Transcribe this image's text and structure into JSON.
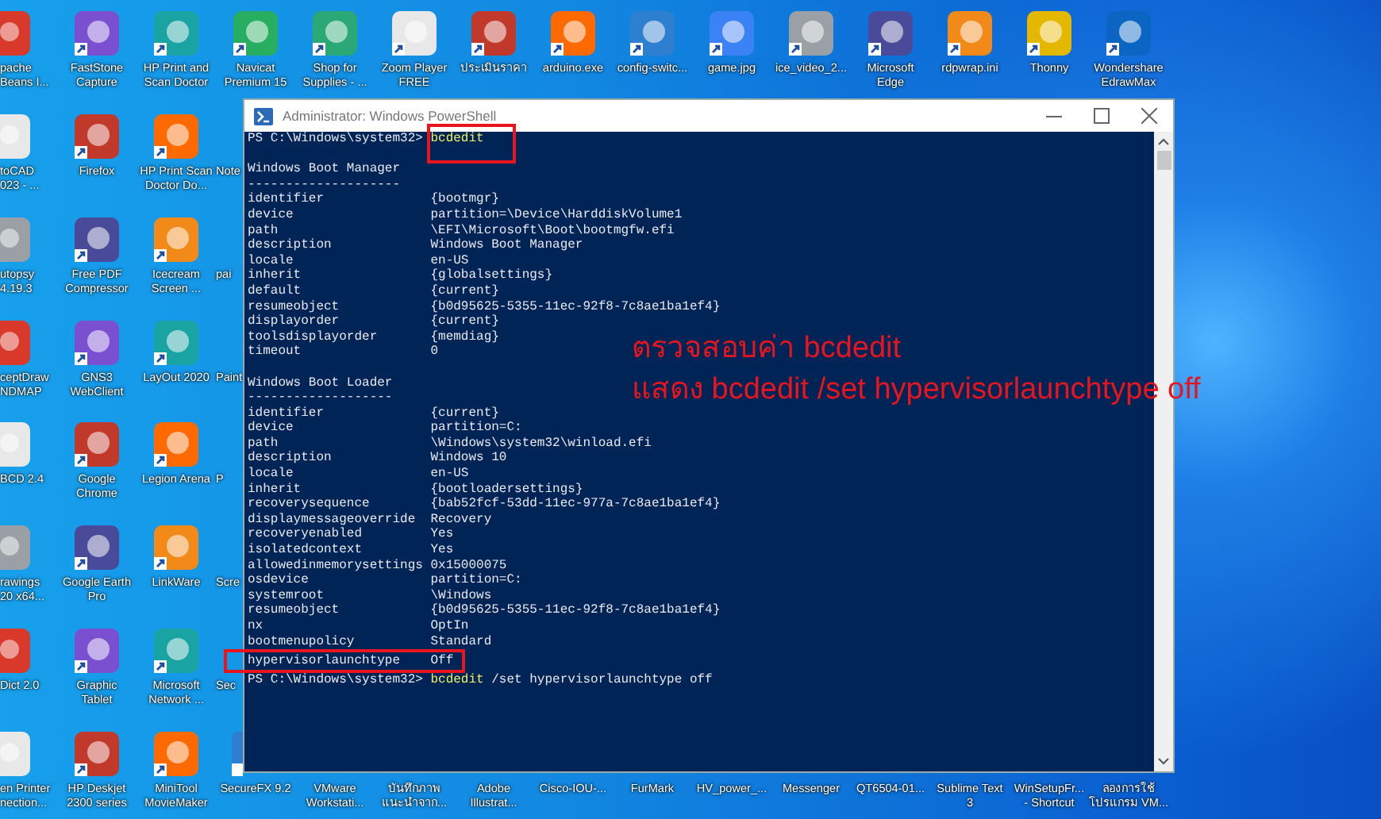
{
  "desktop": {
    "columns": [
      {
        "icons": [
          {
            "label": "pache\nBeans I...",
            "kind": "cut"
          },
          {
            "label": "toCAD\n023 - ...",
            "kind": "cut"
          },
          {
            "label": "utopsy\n4.19.3",
            "kind": "cut"
          },
          {
            "label": "ceptDraw\nNDMAP",
            "kind": "cut"
          },
          {
            "label": "BCD 2.4",
            "kind": "cut"
          },
          {
            "label": "rawings\n20 x64...",
            "kind": "cut"
          },
          {
            "label": "Dict 2.0",
            "kind": "cut"
          },
          {
            "label": "en Printer\nnection...",
            "kind": "cut"
          }
        ]
      },
      {
        "icons": [
          {
            "label": "FastStone\nCapture",
            "kind": "full"
          },
          {
            "label": "Firefox",
            "kind": "full"
          },
          {
            "label": "Free PDF\nCompressor",
            "kind": "full"
          },
          {
            "label": "GNS3\nWebClient",
            "kind": "full"
          },
          {
            "label": "Google\nChrome",
            "kind": "full"
          },
          {
            "label": "Google Earth\nPro",
            "kind": "full"
          },
          {
            "label": "Graphic\nTablet",
            "kind": "full"
          },
          {
            "label": "HP Deskjet\n2300 series",
            "kind": "full"
          }
        ]
      },
      {
        "icons": [
          {
            "label": "HP Print and\nScan Doctor",
            "kind": "full"
          },
          {
            "label": "HP Print Scan\nDoctor Do...",
            "kind": "full"
          },
          {
            "label": "Icecream\nScreen ...",
            "kind": "full"
          },
          {
            "label": "LayOut 2020",
            "kind": "full"
          },
          {
            "label": "Legion Arena",
            "kind": "full"
          },
          {
            "label": "LinkWare",
            "kind": "full"
          },
          {
            "label": "Microsoft\nNetwork ...",
            "kind": "full"
          },
          {
            "label": "MiniTool\nMovieMaker",
            "kind": "full"
          }
        ]
      },
      {
        "icons": [
          {
            "label": "Navicat\nPremium 15",
            "kind": "full"
          },
          {
            "label": "Note",
            "kind": "cut"
          },
          {
            "label": "pai",
            "kind": "cut"
          },
          {
            "label": "Paint",
            "kind": "cut"
          },
          {
            "label": "P",
            "kind": "cut"
          },
          {
            "label": "Scre",
            "kind": "cut"
          },
          {
            "label": "Sec",
            "kind": "cut"
          },
          {
            "label": "SecureFX 9.2",
            "kind": "edge"
          }
        ]
      },
      {
        "icons": [
          {
            "label": "Shop for\nSupplies - ...",
            "kind": "full"
          },
          {
            "label": "VMware\nWorkstati...",
            "kind": "label"
          }
        ]
      },
      {
        "icons": [
          {
            "label": "Zoom Player\nFREE",
            "kind": "full"
          },
          {
            "label": "บันทึกภาพ\nแนะนำจาก...",
            "kind": "label"
          }
        ]
      },
      {
        "icons": [
          {
            "label": "ประเมินราคา",
            "kind": "full"
          },
          {
            "label": "Adobe\nIllustrat...",
            "kind": "label"
          }
        ]
      },
      {
        "icons": [
          {
            "label": "arduino.exe",
            "kind": "full"
          },
          {
            "label": "Cisco-IOU-...",
            "kind": "label"
          }
        ]
      },
      {
        "icons": [
          {
            "label": "config-switc...",
            "kind": "full"
          },
          {
            "label": "FurMark",
            "kind": "label"
          }
        ]
      },
      {
        "icons": [
          {
            "label": "game.jpg",
            "kind": "full"
          },
          {
            "label": "HV_power_...",
            "kind": "label"
          }
        ]
      },
      {
        "icons": [
          {
            "label": "ice_video_2...",
            "kind": "full"
          },
          {
            "label": "Messenger",
            "kind": "label"
          }
        ]
      },
      {
        "icons": [
          {
            "label": "Microsoft\nEdge",
            "kind": "full"
          },
          {
            "label": "QT6504-01...",
            "kind": "label"
          }
        ]
      },
      {
        "icons": [
          {
            "label": "rdpwrap.ini",
            "kind": "full"
          },
          {
            "label": "Sublime Text\n3",
            "kind": "label"
          }
        ]
      },
      {
        "icons": [
          {
            "label": "Thonny",
            "kind": "full"
          },
          {
            "label": "WinSetupFr...\n- Shortcut",
            "kind": "label"
          }
        ]
      },
      {
        "icons": [
          {
            "label": "Wondershare\nEdrawMax",
            "kind": "full"
          },
          {
            "label": "ลองการใช้\nโปรแกรม VM...",
            "kind": "label"
          }
        ]
      }
    ]
  },
  "window": {
    "title": "Administrator: Windows PowerShell",
    "lines": [
      {
        "kind": "prompt",
        "prompt": "PS C:\\Windows\\system32>",
        "command": "bcdedit",
        "highlighted": true
      },
      {
        "kind": "blank"
      },
      {
        "kind": "heading",
        "text": "Windows Boot Manager"
      },
      {
        "kind": "heading",
        "text": "--------------------"
      },
      {
        "kind": "entry",
        "key": "identifier",
        "value": "{bootmgr}"
      },
      {
        "kind": "entry",
        "key": "device",
        "value": "partition=\\Device\\HarddiskVolume1"
      },
      {
        "kind": "entry",
        "key": "path",
        "value": "\\EFI\\Microsoft\\Boot\\bootmgfw.efi"
      },
      {
        "kind": "entry",
        "key": "description",
        "value": "Windows Boot Manager"
      },
      {
        "kind": "entry",
        "key": "locale",
        "value": "en-US"
      },
      {
        "kind": "entry",
        "key": "inherit",
        "value": "{globalsettings}"
      },
      {
        "kind": "entry",
        "key": "default",
        "value": "{current}"
      },
      {
        "kind": "entry",
        "key": "resumeobject",
        "value": "{b0d95625-5355-11ec-92f8-7c8ae1ba1ef4}"
      },
      {
        "kind": "entry",
        "key": "displayorder",
        "value": "{current}"
      },
      {
        "kind": "entry",
        "key": "toolsdisplayorder",
        "value": "{memdiag}"
      },
      {
        "kind": "entry",
        "key": "timeout",
        "value": "0"
      },
      {
        "kind": "blank"
      },
      {
        "kind": "heading",
        "text": "Windows Boot Loader"
      },
      {
        "kind": "heading",
        "text": "-------------------"
      },
      {
        "kind": "entry",
        "key": "identifier",
        "value": "{current}"
      },
      {
        "kind": "entry",
        "key": "device",
        "value": "partition=C:"
      },
      {
        "kind": "entry",
        "key": "path",
        "value": "\\Windows\\system32\\winload.efi"
      },
      {
        "kind": "entry",
        "key": "description",
        "value": "Windows 10"
      },
      {
        "kind": "entry",
        "key": "locale",
        "value": "en-US"
      },
      {
        "kind": "entry",
        "key": "inherit",
        "value": "{bootloadersettings}"
      },
      {
        "kind": "entry",
        "key": "recoverysequence",
        "value": "{bab52fcf-53dd-11ec-977a-7c8ae1ba1ef4}"
      },
      {
        "kind": "entry",
        "key": "displaymessageoverride",
        "value": "Recovery"
      },
      {
        "kind": "entry",
        "key": "recoveryenabled",
        "value": "Yes"
      },
      {
        "kind": "entry",
        "key": "isolatedcontext",
        "value": "Yes"
      },
      {
        "kind": "entry",
        "key": "allowedinmemorysettings",
        "value": "0x15000075"
      },
      {
        "kind": "entry",
        "key": "osdevice",
        "value": "partition=C:"
      },
      {
        "kind": "entry",
        "key": "systemroot",
        "value": "\\Windows"
      },
      {
        "kind": "entry",
        "key": "resumeobject",
        "value": "{b0d95625-5355-11ec-92f8-7c8ae1ba1ef4}"
      },
      {
        "kind": "entry",
        "key": "nx",
        "value": "OptIn"
      },
      {
        "kind": "entry",
        "key": "bootmenupolicy",
        "value": "Standard"
      },
      {
        "kind": "entry",
        "key": "hypervisorlaunchtype",
        "value": "Off",
        "highlighted": true
      },
      {
        "kind": "prompt",
        "prompt": "PS C:\\Windows\\system32>",
        "command": "bcdedit",
        "args": "/set hypervisorlaunchtype off"
      }
    ]
  },
  "annotation": {
    "lines": [
      "ตรวจสอบค่า bcdedit",
      "แสดง bcdedit /set hypervisorlaunchtype off"
    ]
  }
}
